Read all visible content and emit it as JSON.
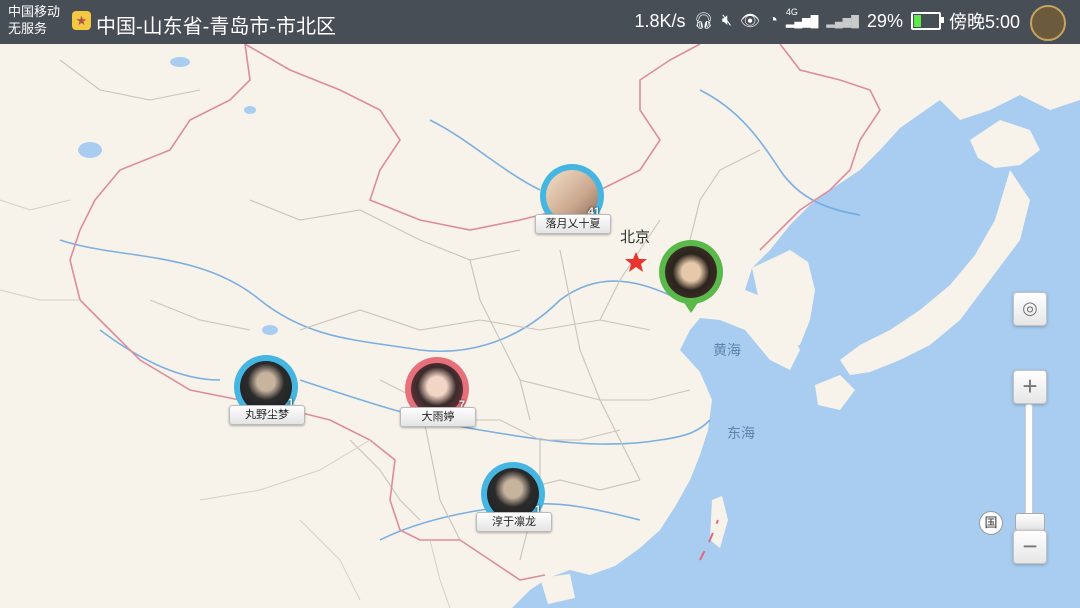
{
  "status_bar": {
    "carrier_line1": "中国移动",
    "carrier_line2": "无服务",
    "location": "中国-山东省-青岛市-市北区",
    "network_speed": "1.8K/s",
    "network_type": "4G",
    "battery_percent": "29%",
    "battery_level": 0.29,
    "time": "傍晚5:00",
    "icons": [
      "headset-icon",
      "mute-icon",
      "eye-icon",
      "wifi-icon",
      "signal-icon",
      "no-signal-icon",
      "battery-icon"
    ]
  },
  "map": {
    "labels": {
      "beijing": "北京",
      "yellow_sea": "黄海",
      "east_sea": "东海"
    },
    "colors": {
      "water": "#a9cdf0",
      "land": "#f7f3ea",
      "border": "#dd8c9c",
      "river": "#6fa8e0"
    }
  },
  "markers": [
    {
      "name": "落月乂十夏",
      "count": "41",
      "color": "#45b5e2"
    },
    {
      "name": "丸野尘梦",
      "count": "1",
      "color": "#45b5e2"
    },
    {
      "name": "大雨婷",
      "count": "7",
      "color": "#e8707a"
    },
    {
      "name": "淳于凛龙",
      "count": "1",
      "color": "#45b5e2"
    },
    {
      "name": "",
      "count": "",
      "color": "#5bb84a"
    }
  ],
  "controls": {
    "zoom_in": "+",
    "zoom_out": "−",
    "zoom_level_label": "国",
    "locate_icon": "locate-icon"
  }
}
